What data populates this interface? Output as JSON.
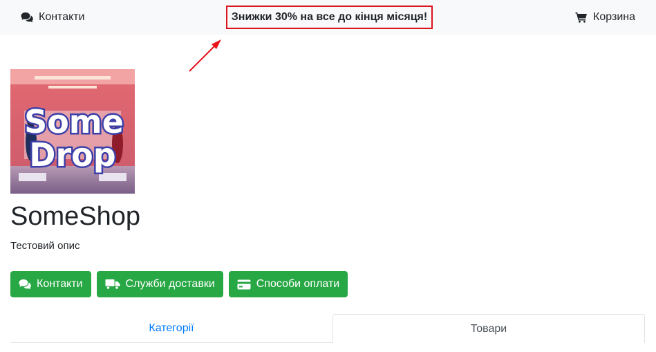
{
  "header": {
    "contacts_label": "Контакти",
    "promo_text": "Знижки 30% на все до кінця місяця!",
    "cart_label": "Корзина"
  },
  "logo": {
    "line1": "Some",
    "line2": "Drop"
  },
  "shop": {
    "name": "SomeShop",
    "description": "Тестовий опис"
  },
  "buttons": {
    "contacts": "Контакти",
    "delivery": "Служби доставки",
    "payment": "Способи оплати"
  },
  "tabs": {
    "categories": "Категорії",
    "products": "Товари"
  },
  "icons": {
    "contacts": "comments-icon",
    "cart": "shopping-cart-icon",
    "delivery": "truck-icon",
    "payment": "credit-card-icon"
  },
  "colors": {
    "button_green": "#28a745",
    "promo_border": "#d9141c",
    "tab_link": "#007bff",
    "topbar_bg": "#f8f9fa"
  }
}
